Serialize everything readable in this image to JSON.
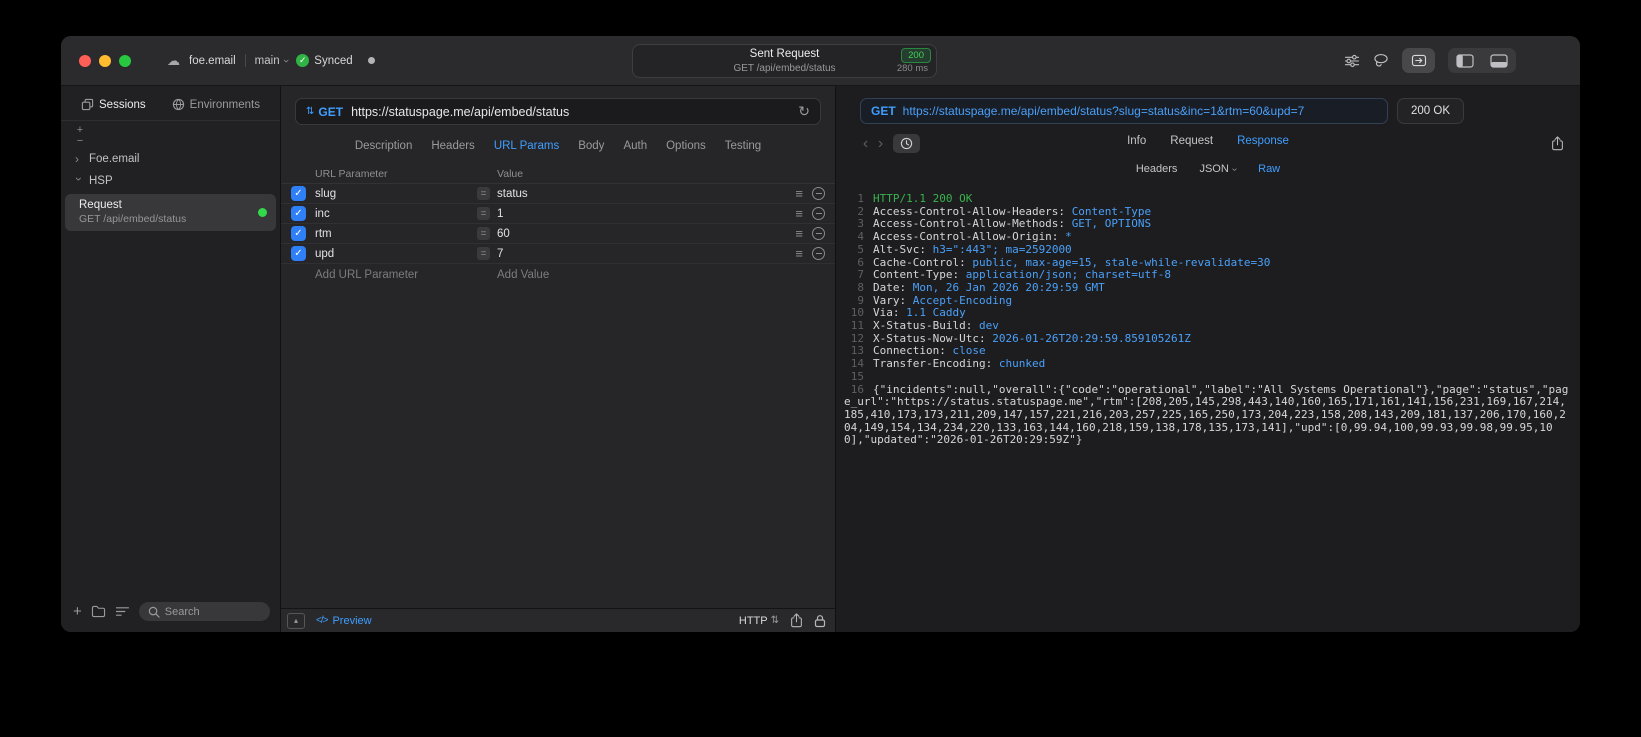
{
  "colors": {
    "accent_blue": "#3f9eff",
    "value_blue": "#4aa0f8",
    "status_green": "#32d74b"
  },
  "icons": {
    "cloud": "☁",
    "check": "✓",
    "sort_updown": "⇅",
    "refresh": "↻",
    "chevron_right": "›",
    "back": "‹",
    "forward": "›",
    "equals": "=",
    "menu_lines": "≡",
    "panel_up": "▴",
    "code": "</>",
    "plus": "+",
    "minus": "−"
  },
  "titlebar": {
    "project": "foe.email",
    "branch": "main",
    "sync_label": "Synced",
    "request_title": "Sent Request",
    "status_badge": "200",
    "request_subtitle": "GET /api/embed/status",
    "duration": "280 ms"
  },
  "sidebar": {
    "tabs": [
      {
        "label": "Sessions"
      },
      {
        "label": "Environments"
      }
    ],
    "tree": [
      {
        "label": "Foe.email"
      },
      {
        "label": "HSP"
      }
    ],
    "request_item": {
      "title": "Request",
      "subtitle": "GET /api/embed/status"
    },
    "search_placeholder": "Search"
  },
  "request_editor": {
    "method": "GET",
    "url": "https://statuspage.me/api/embed/status",
    "tabs": [
      "Description",
      "Headers",
      "URL Params",
      "Body",
      "Auth",
      "Options",
      "Testing"
    ],
    "active_tab": "URL Params",
    "table": {
      "col_param": "URL Parameter",
      "col_value": "Value",
      "rows": [
        {
          "name": "slug",
          "value": "status",
          "checked": true
        },
        {
          "name": "inc",
          "value": "1",
          "checked": true
        },
        {
          "name": "rtm",
          "value": "60",
          "checked": true
        },
        {
          "name": "upd",
          "value": "7",
          "checked": true
        }
      ],
      "add_param": "Add URL Parameter",
      "add_value": "Add Value"
    },
    "footer": {
      "preview": "Preview",
      "protocol": "HTTP"
    }
  },
  "response_viewer": {
    "method": "GET",
    "url": "https://statuspage.me/api/embed/status?slug=status&inc=1&rtm=60&upd=7",
    "status": "200 OK",
    "tabs": [
      "Info",
      "Request",
      "Response"
    ],
    "active_tab": "Response",
    "subtabs": [
      {
        "label": "Headers"
      },
      {
        "label": "JSON",
        "dropdown": true
      },
      {
        "label": "Raw"
      }
    ],
    "active_subtab": "Raw",
    "body_lines": [
      {
        "n": "1",
        "seg": [
          {
            "c": "green",
            "t": "HTTP/1.1 200 OK"
          }
        ]
      },
      {
        "n": "2",
        "seg": [
          {
            "c": "plain",
            "t": "Access-Control-Allow-Headers: "
          },
          {
            "c": "blue",
            "t": "Content-Type"
          }
        ]
      },
      {
        "n": "3",
        "seg": [
          {
            "c": "plain",
            "t": "Access-Control-Allow-Methods: "
          },
          {
            "c": "blue",
            "t": "GET, OPTIONS"
          }
        ]
      },
      {
        "n": "4",
        "seg": [
          {
            "c": "plain",
            "t": "Access-Control-Allow-Origin: "
          },
          {
            "c": "blue",
            "t": "*"
          }
        ]
      },
      {
        "n": "5",
        "seg": [
          {
            "c": "plain",
            "t": "Alt-Svc: "
          },
          {
            "c": "blue",
            "t": "h3=\":443\"; ma=2592000"
          }
        ]
      },
      {
        "n": "6",
        "seg": [
          {
            "c": "plain",
            "t": "Cache-Control: "
          },
          {
            "c": "blue",
            "t": "public, max-age=15, stale-while-revalidate=30"
          }
        ]
      },
      {
        "n": "7",
        "seg": [
          {
            "c": "plain",
            "t": "Content-Type: "
          },
          {
            "c": "blue",
            "t": "application/json; charset=utf-8"
          }
        ]
      },
      {
        "n": "8",
        "seg": [
          {
            "c": "plain",
            "t": "Date: "
          },
          {
            "c": "blue",
            "t": "Mon, 26 Jan 2026 20:29:59 GMT"
          }
        ]
      },
      {
        "n": "9",
        "seg": [
          {
            "c": "plain",
            "t": "Vary: "
          },
          {
            "c": "blue",
            "t": "Accept-Encoding"
          }
        ]
      },
      {
        "n": "10",
        "seg": [
          {
            "c": "plain",
            "t": "Via: "
          },
          {
            "c": "blue",
            "t": "1.1 Caddy"
          }
        ]
      },
      {
        "n": "11",
        "seg": [
          {
            "c": "plain",
            "t": "X-Status-Build: "
          },
          {
            "c": "blue",
            "t": "dev"
          }
        ]
      },
      {
        "n": "12",
        "seg": [
          {
            "c": "plain",
            "t": "X-Status-Now-Utc: "
          },
          {
            "c": "blue",
            "t": "2026-01-26T20:29:59.859105261Z"
          }
        ]
      },
      {
        "n": "13",
        "seg": [
          {
            "c": "plain",
            "t": "Connection: "
          },
          {
            "c": "blue",
            "t": "close"
          }
        ]
      },
      {
        "n": "14",
        "seg": [
          {
            "c": "plain",
            "t": "Transfer-Encoding: "
          },
          {
            "c": "blue",
            "t": "chunked"
          }
        ]
      },
      {
        "n": "15",
        "seg": []
      },
      {
        "n": "16",
        "seg": [
          {
            "c": "plain",
            "t": "{\"incidents\":null,\"overall\":{\"code\":\"operational\",\"label\":\"All Systems Operational\"},\"page\":\"status\",\"page_url\":\"https://status.statuspage.me\",\"rtm\":[208,205,145,298,443,140,160,165,171,161,141,156,231,169,167,214,185,410,173,173,211,209,147,157,221,216,203,257,225,165,250,173,204,223,158,208,143,209,181,137,206,170,160,204,149,154,134,234,220,133,163,144,160,218,159,138,178,135,173,141],\"upd\":[0,99.94,100,99.93,99.98,99.95,100],\"updated\":\"2026-01-26T20:29:59Z\"}"
          }
        ]
      }
    ]
  }
}
